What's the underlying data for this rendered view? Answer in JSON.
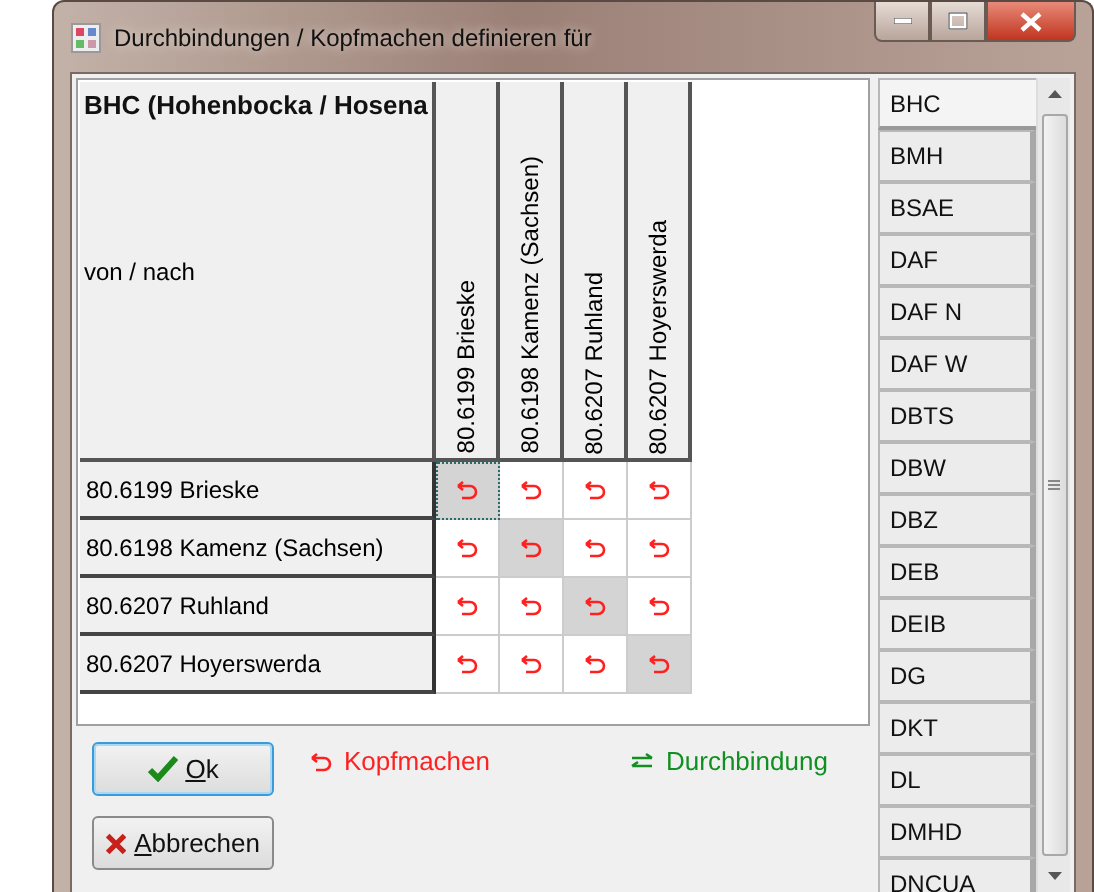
{
  "window": {
    "title": "Durchbindungen / Kopfmachen definieren für"
  },
  "grid": {
    "title": "BHC (Hohenbocka / Hosena",
    "corner_label": "von / nach",
    "columns": [
      "80.6199 Brieske",
      "80.6198 Kamenz (Sachsen)",
      "80.6207 Ruhland",
      "80.6207 Hoyerswerda"
    ],
    "rows": [
      {
        "label": "80.6199 Brieske",
        "cells": [
          {
            "kind": "kopfmachen",
            "shaded": true,
            "focused": true
          },
          {
            "kind": "kopfmachen",
            "shaded": false,
            "focused": false
          },
          {
            "kind": "kopfmachen",
            "shaded": false,
            "focused": false
          },
          {
            "kind": "kopfmachen",
            "shaded": false,
            "focused": false
          }
        ]
      },
      {
        "label": "80.6198 Kamenz (Sachsen)",
        "cells": [
          {
            "kind": "kopfmachen",
            "shaded": false,
            "focused": false
          },
          {
            "kind": "kopfmachen",
            "shaded": true,
            "focused": false
          },
          {
            "kind": "kopfmachen",
            "shaded": false,
            "focused": false
          },
          {
            "kind": "kopfmachen",
            "shaded": false,
            "focused": false
          }
        ]
      },
      {
        "label": "80.6207 Ruhland",
        "cells": [
          {
            "kind": "kopfmachen",
            "shaded": false,
            "focused": false
          },
          {
            "kind": "kopfmachen",
            "shaded": false,
            "focused": false
          },
          {
            "kind": "kopfmachen",
            "shaded": true,
            "focused": false
          },
          {
            "kind": "kopfmachen",
            "shaded": false,
            "focused": false
          }
        ]
      },
      {
        "label": "80.6207 Hoyerswerda",
        "cells": [
          {
            "kind": "kopfmachen",
            "shaded": false,
            "focused": false
          },
          {
            "kind": "kopfmachen",
            "shaded": false,
            "focused": false
          },
          {
            "kind": "kopfmachen",
            "shaded": false,
            "focused": false
          },
          {
            "kind": "kopfmachen",
            "shaded": true,
            "focused": false
          }
        ]
      }
    ]
  },
  "legend": [
    {
      "kind": "kopfmachen",
      "label": "Kopfmachen"
    },
    {
      "kind": "durchbindung",
      "label": "Durchbindung"
    }
  ],
  "buttons": [
    {
      "kind": "ok",
      "label": "Ok",
      "default": true
    },
    {
      "kind": "cancel",
      "label": "Abbrechen",
      "default": false
    }
  ],
  "stations": [
    {
      "label": "BHC",
      "selected": true
    },
    {
      "label": "BMH",
      "selected": false
    },
    {
      "label": "BSAE",
      "selected": false
    },
    {
      "label": "DAF",
      "selected": false
    },
    {
      "label": "DAF N",
      "selected": false
    },
    {
      "label": "DAF W",
      "selected": false
    },
    {
      "label": "DBTS",
      "selected": false
    },
    {
      "label": "DBW",
      "selected": false
    },
    {
      "label": "DBZ",
      "selected": false
    },
    {
      "label": "DEB",
      "selected": false
    },
    {
      "label": "DEIB",
      "selected": false
    },
    {
      "label": "DG",
      "selected": false
    },
    {
      "label": "DKT",
      "selected": false
    },
    {
      "label": "DL",
      "selected": false
    },
    {
      "label": "DMHD",
      "selected": false
    },
    {
      "label": "DNCUA",
      "selected": false
    }
  ]
}
